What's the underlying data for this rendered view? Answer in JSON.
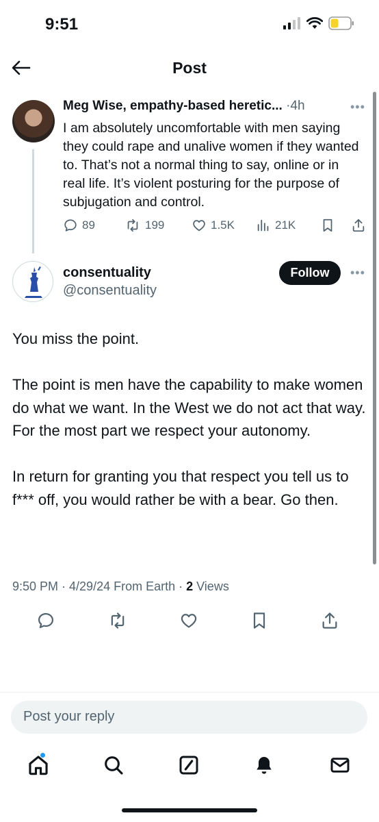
{
  "status": {
    "time": "9:51"
  },
  "header": {
    "title": "Post"
  },
  "parent_tweet": {
    "author": "Meg Wise, empathy-based heretic...",
    "separator": "·",
    "time": "4h",
    "text": "I am absolutely uncomfortable with men saying they could rape and unalive women if they wanted to. That’s not a normal thing to say, online or in real life. It’s violent posturing for the purpose of subjugation and control.",
    "replies": "89",
    "reposts": "199",
    "likes": "1.5K",
    "views": "21K"
  },
  "main_tweet": {
    "author": "consentuality",
    "handle": "@consentuality",
    "follow_label": "Follow",
    "paragraphs": [
      "You miss the point.",
      "The point is men have the capability to make women do what we want. In the West we do not act that way. For the most part we respect your autonomy.",
      "In return for granting you that respect you tell us to f*** off, you would rather be with a bear. Go then."
    ],
    "timestamp": "9:50 PM · 4/29/24 From Earth · ",
    "views_count": "2",
    "views_label": " Views"
  },
  "reply": {
    "placeholder": "Post your reply"
  },
  "colors": {
    "accent": "#1d9bf0",
    "text": "#0f1419",
    "muted": "#536471"
  }
}
